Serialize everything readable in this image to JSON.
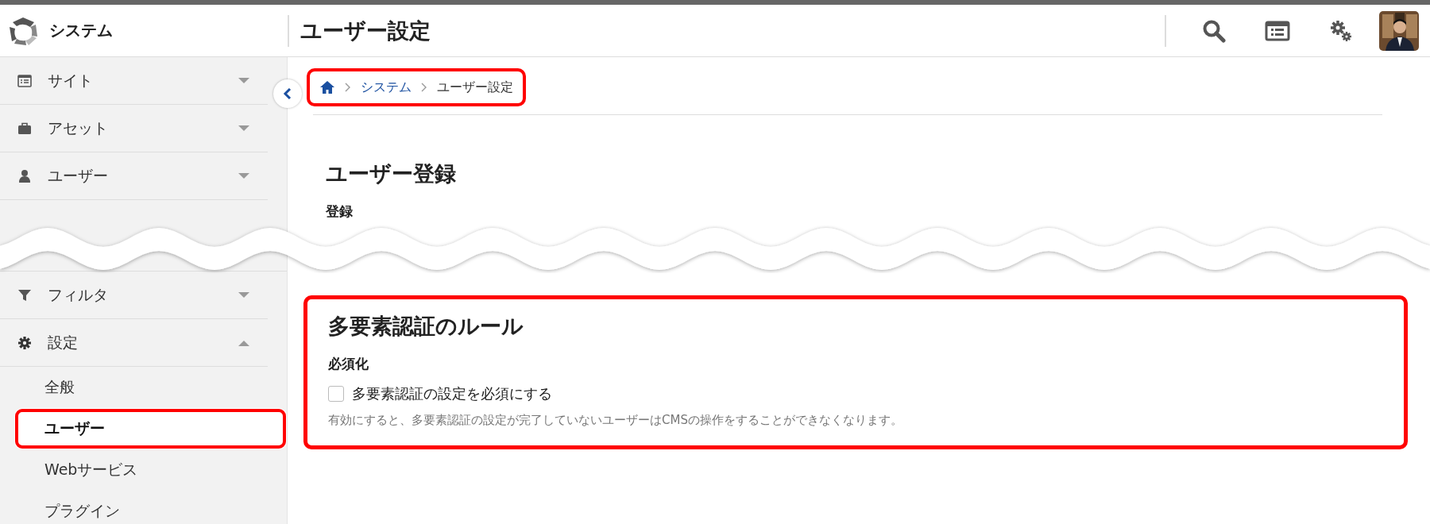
{
  "header": {
    "app_name": "システム",
    "page_title": "ユーザー設定"
  },
  "sidebar": {
    "items": [
      {
        "label": "サイト",
        "expanded": false
      },
      {
        "label": "アセット",
        "expanded": false
      },
      {
        "label": "ユーザー",
        "expanded": false
      },
      {
        "label": "フィルタ",
        "expanded": false
      },
      {
        "label": "設定",
        "expanded": true,
        "children": [
          {
            "label": "全般",
            "selected": false,
            "highlighted": false
          },
          {
            "label": "ユーザー",
            "selected": true,
            "highlighted": true
          },
          {
            "label": "Webサービス",
            "selected": false,
            "highlighted": false
          },
          {
            "label": "プラグイン",
            "selected": false,
            "highlighted": false
          }
        ]
      }
    ]
  },
  "breadcrumb": {
    "highlighted": true,
    "items": [
      {
        "label": "システム",
        "kind": "link"
      },
      {
        "label": "ユーザー設定",
        "kind": "current"
      }
    ]
  },
  "registration": {
    "title": "ユーザー登録",
    "subtitle": "登録"
  },
  "mfa_card": {
    "highlighted": true,
    "title": "多要素認証のルール",
    "field_label": "必須化",
    "checkbox": {
      "label": "多要素認証の設定を必須にする",
      "checked": false
    },
    "help": "有効にすると、多要素認証の設定が完了していないユーザーはCMSの操作をすることができなくなります。"
  }
}
